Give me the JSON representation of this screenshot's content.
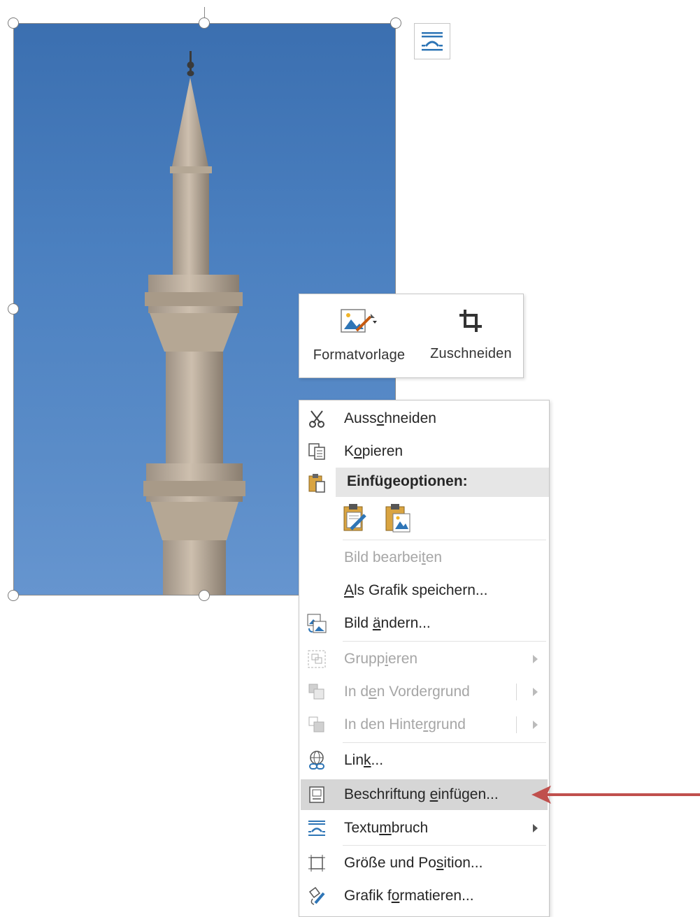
{
  "image": {
    "alt": "Minaret",
    "layout_options_icon": "wrap-text-icon"
  },
  "minibar": {
    "style_label": "Formatvorlage",
    "crop_label": "Zuschneiden"
  },
  "menu": {
    "cut": {
      "pre": "Auss",
      "u": "c",
      "post": "hneiden",
      "icon": "scissors-icon"
    },
    "copy": {
      "pre": "K",
      "u": "o",
      "post": "pieren",
      "icon": "copy-icon"
    },
    "paste_options": {
      "label": "Einfügeoptionen:",
      "icon": "clipboard-icon"
    },
    "edit_picture": {
      "pre": "Bild bearbei",
      "u": "t",
      "post": "en",
      "disabled": true
    },
    "save_as_picture": {
      "pre": "",
      "u": "A",
      "post": "ls Grafik speichern..."
    },
    "change_picture": {
      "pre": "Bild ",
      "u": "ä",
      "post": "ndern...",
      "icon": "change-picture-icon"
    },
    "group": {
      "pre": "Grupp",
      "u": "i",
      "post": "eren",
      "disabled": true,
      "icon": "group-icon"
    },
    "bring_forward": {
      "pre": "In d",
      "u": "e",
      "post": "n Vordergrund",
      "disabled": true,
      "icon": "bring-forward-icon"
    },
    "send_backward": {
      "pre": "In den Hinte",
      "u": "r",
      "post": "grund",
      "disabled": true,
      "icon": "send-backward-icon"
    },
    "link": {
      "pre": "Lin",
      "u": "k",
      "post": "...",
      "icon": "link-icon"
    },
    "insert_caption": {
      "pre": "Beschriftung ",
      "u": "e",
      "post": "infügen...",
      "icon": "caption-icon",
      "highlighted": true
    },
    "wrap_text": {
      "pre": "Textu",
      "u": "m",
      "post": "bruch",
      "icon": "wrap-text-icon"
    },
    "size_position": {
      "pre": "Größe und Po",
      "u": "s",
      "post": "ition...",
      "icon": "size-position-icon"
    },
    "format_picture": {
      "pre": "Grafik f",
      "u": "o",
      "post": "rmatieren...",
      "icon": "format-picture-icon"
    }
  },
  "colors": {
    "accent_arrow": "#c0504d",
    "highlight": "#d6d6d6",
    "sky": "#4b80c0"
  }
}
